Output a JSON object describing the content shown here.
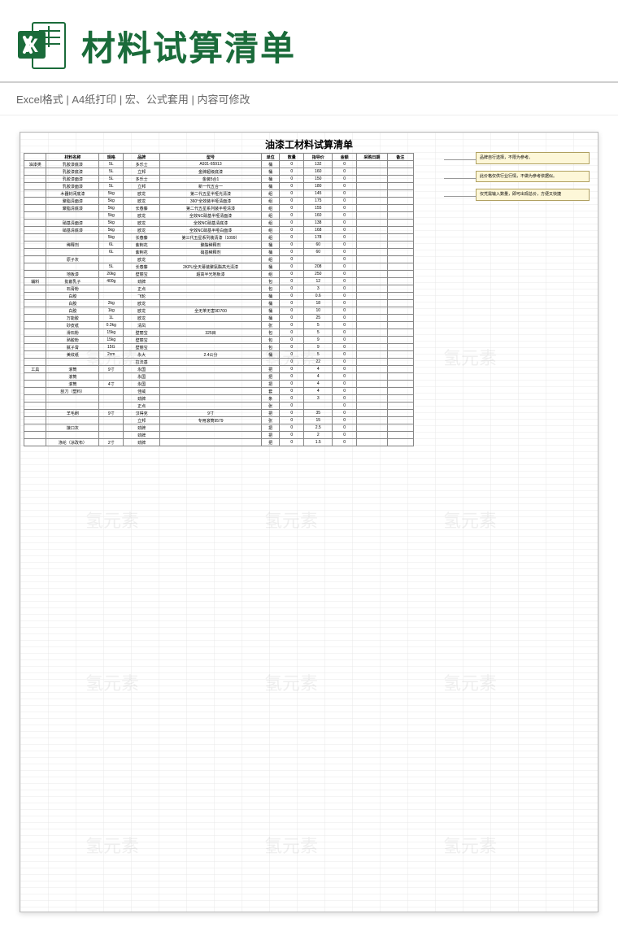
{
  "header": {
    "title": "材料试算清单",
    "subtitle": "Excel格式 |  A4纸打印 | 宏、公式套用 | 内容可修改"
  },
  "sheet": {
    "title": "油漆工材料试算清单",
    "columns": [
      "",
      "材料名称",
      "规格",
      "品牌",
      "型号",
      "单位",
      "数量",
      "指导价",
      "金额",
      "采购日期",
      "备注"
    ],
    "sections": [
      {
        "category": "油漆类",
        "rows": [
          {
            "name": "乳胶漆底漆",
            "spec": "5L",
            "brand": "多乐士",
            "model": "A931-65913",
            "unit": "桶",
            "qty": "0",
            "price": "132",
            "total": "0"
          },
          {
            "name": "乳胶漆底漆",
            "spec": "5L",
            "brand": "立邦",
            "model": "金牌超级底漆",
            "unit": "桶",
            "qty": "0",
            "price": "160",
            "total": "0"
          },
          {
            "name": "乳胶漆面漆",
            "spec": "5L",
            "brand": "多乐士",
            "model": "金装5合1",
            "unit": "桶",
            "qty": "0",
            "price": "150",
            "total": "0"
          },
          {
            "name": "乳胶漆面漆",
            "spec": "5L",
            "brand": "立邦",
            "model": "新一代五合一",
            "unit": "桶",
            "qty": "0",
            "price": "180",
            "total": "0"
          },
          {
            "name": "木器封闭底漆",
            "spec": "5kg",
            "brand": "欧龙",
            "model": "第二代五星半哑光清漆",
            "unit": "组",
            "qty": "0",
            "price": "145",
            "total": "0"
          },
          {
            "name": "聚脂清面漆",
            "spec": "5kg",
            "brand": "欧龙",
            "model": "360°全效装半哑清面漆",
            "unit": "组",
            "qty": "0",
            "price": "175",
            "total": "0"
          },
          {
            "name": "聚脂清底漆",
            "spec": "5kg",
            "brand": "长春藤",
            "model": "第二代五星系列装半哑清漆",
            "unit": "组",
            "qty": "0",
            "price": "155",
            "total": "0"
          },
          {
            "name": "",
            "spec": "5kg",
            "brand": "欧龙",
            "model": "全效NC硝基半哑清面漆",
            "unit": "组",
            "qty": "0",
            "price": "160",
            "total": "0"
          },
          {
            "name": "硝基清面漆",
            "spec": "5kg",
            "brand": "欧龙",
            "model": "全效NC硝基清底漆",
            "unit": "组",
            "qty": "0",
            "price": "138",
            "total": "0"
          },
          {
            "name": "硝基清底漆",
            "spec": "5kg",
            "brand": "欧龙",
            "model": "全效NC硝基半哑白面漆",
            "unit": "组",
            "qty": "0",
            "price": "168",
            "total": "0"
          },
          {
            "name": "",
            "spec": "5kg",
            "brand": "长春藤",
            "model": "第三代五星系列装清漆（1099）",
            "unit": "组",
            "qty": "0",
            "price": "178",
            "total": "0"
          },
          {
            "name": "稀释剂",
            "spec": "6L",
            "brand": "紫荆花",
            "model": "聚酯稀释剂",
            "unit": "桶",
            "qty": "0",
            "price": "60",
            "total": "0"
          },
          {
            "name": "",
            "spec": "6L",
            "brand": "紫荆花",
            "model": "硝基稀释剂",
            "unit": "桶",
            "qty": "0",
            "price": "60",
            "total": "0"
          },
          {
            "name": "原子灰",
            "spec": "",
            "brand": "欧龙",
            "model": "",
            "unit": "组",
            "qty": "0",
            "price": "",
            "total": "0"
          },
          {
            "name": "",
            "spec": "5L",
            "brand": "长春藤",
            "model": "2KPU全天幕装聚氨酯高光清漆",
            "unit": "桶",
            "qty": "0",
            "price": "208",
            "total": "0"
          },
          {
            "name": "地板漆",
            "spec": "20kg",
            "brand": "壁丽宝",
            "model": "超高半光地板漆",
            "unit": "组",
            "qty": "0",
            "price": "250",
            "total": "0"
          }
        ]
      },
      {
        "category": "辅料",
        "rows": [
          {
            "name": "批嵌乳子",
            "spec": "400g",
            "brand": "劲牌",
            "model": "",
            "unit": "包",
            "qty": "0",
            "price": "12",
            "total": "0"
          },
          {
            "name": "石膏粉",
            "spec": "",
            "brand": "正点",
            "model": "",
            "unit": "包",
            "qty": "0",
            "price": "3",
            "total": "0"
          },
          {
            "name": "白胶",
            "spec": "",
            "brand": "飞轮",
            "model": "",
            "unit": "桶",
            "qty": "0",
            "price": "0.6",
            "total": "0"
          },
          {
            "name": "白胶",
            "spec": "2kg",
            "brand": "欧龙",
            "model": "",
            "unit": "桶",
            "qty": "0",
            "price": "18",
            "total": "0"
          },
          {
            "name": "白胶",
            "spec": "1kg",
            "brand": "欧龙",
            "model": "全无苯无害9D700",
            "unit": "桶",
            "qty": "0",
            "price": "10",
            "total": "0"
          },
          {
            "name": "万能胶",
            "spec": "1L",
            "brand": "欧龙",
            "model": "",
            "unit": "桶",
            "qty": "0",
            "price": "25",
            "total": "0"
          },
          {
            "name": "砂皮纸",
            "spec": "0.3kg",
            "brand": "清凤",
            "model": "",
            "unit": "张",
            "qty": "0",
            "price": "5",
            "total": "0"
          },
          {
            "name": "滑石粉",
            "spec": "15kg",
            "brand": "壁丽宝",
            "model": "325目",
            "unit": "包",
            "qty": "0",
            "price": "5",
            "total": "0"
          },
          {
            "name": "熟胶粉",
            "spec": "15kg",
            "brand": "壁丽宝",
            "model": "",
            "unit": "包",
            "qty": "0",
            "price": "9",
            "total": "0"
          },
          {
            "name": "腻子膏",
            "spec": "15G",
            "brand": "壁丽宝",
            "model": "",
            "unit": "包",
            "qty": "0",
            "price": "9",
            "total": "0"
          },
          {
            "name": "美纹纸",
            "spec": "2cm",
            "brand": "永大",
            "model": "2.4公分",
            "unit": "桶",
            "qty": "0",
            "price": "5",
            "total": "0"
          },
          {
            "name": "",
            "spec": "",
            "brand": "拉法基",
            "model": "",
            "unit": "",
            "qty": "0",
            "price": "22",
            "total": "0"
          }
        ]
      },
      {
        "category": "工具",
        "rows": [
          {
            "name": "滚筒",
            "spec": "9寸",
            "brand": "永国",
            "model": "",
            "unit": "把",
            "qty": "0",
            "price": "4",
            "total": "0"
          },
          {
            "name": "滚筒",
            "spec": "",
            "brand": "永国",
            "model": "",
            "unit": "把",
            "qty": "0",
            "price": "4",
            "total": "0"
          },
          {
            "name": "滚筒",
            "spec": "4寸",
            "brand": "永国",
            "model": "",
            "unit": "把",
            "qty": "0",
            "price": "4",
            "total": "0"
          },
          {
            "name": "刮刀（塑料）",
            "spec": "",
            "brand": "佳威",
            "model": "",
            "unit": "套",
            "qty": "0",
            "price": "4",
            "total": "0"
          },
          {
            "name": "",
            "spec": "",
            "brand": "劲牌",
            "model": "",
            "unit": "条",
            "qty": "0",
            "price": "3",
            "total": "0"
          },
          {
            "name": "",
            "spec": "",
            "brand": "正点",
            "model": "",
            "unit": "张",
            "qty": "0",
            "price": "",
            "total": "0"
          },
          {
            "name": "羊毛刷",
            "spec": "9寸",
            "brand": "汉得克",
            "model": "9寸",
            "unit": "把",
            "qty": "0",
            "price": "35",
            "total": "0"
          },
          {
            "name": "",
            "spec": "",
            "brand": "立邦",
            "model": "专用滚筒9579",
            "unit": "张",
            "qty": "0",
            "price": "15",
            "total": "0"
          },
          {
            "name": "接口灰",
            "spec": "",
            "brand": "劲牌",
            "model": "",
            "unit": "把",
            "qty": "0",
            "price": "2.5",
            "total": "0"
          },
          {
            "name": "",
            "spec": "",
            "brand": "劲牌",
            "model": "",
            "unit": "把",
            "qty": "0",
            "price": "2",
            "total": "0"
          },
          {
            "name": "涤纶（涂改布）",
            "spec": "2寸",
            "brand": "劲牌",
            "model": "",
            "unit": "把",
            "qty": "0",
            "price": "1.5",
            "total": "0"
          }
        ]
      }
    ]
  },
  "notes": [
    "品牌自行选择，不限为参考。",
    "此价格仅供行业行情，不做为参考依据似。",
    "仅凭需输入数量，即可出现总价，方便又快捷"
  ],
  "watermark": "氢元素"
}
